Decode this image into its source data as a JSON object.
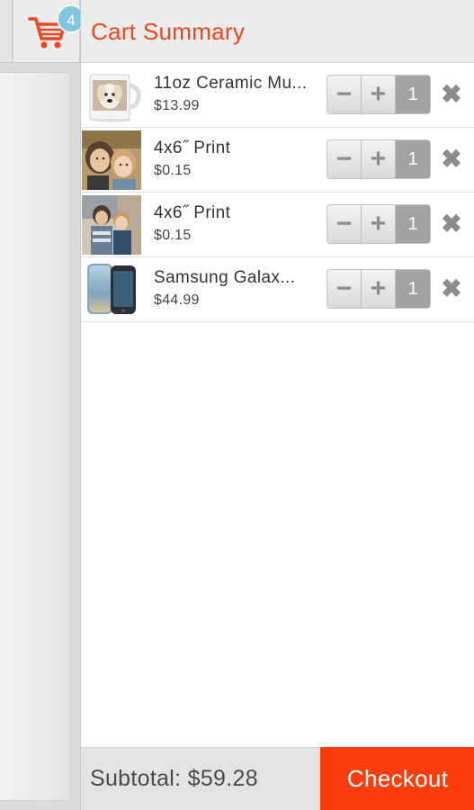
{
  "header": {
    "title": "Cart Summary",
    "cart_count": "4",
    "cart_icon": "shopping-cart-icon"
  },
  "items": [
    {
      "name": "11oz Ceramic Mu...",
      "price": "$13.99",
      "quantity": "1"
    },
    {
      "name": "4x6˝ Print",
      "price": "$0.15",
      "quantity": "1"
    },
    {
      "name": "4x6˝ Print",
      "price": "$0.15",
      "quantity": "1"
    },
    {
      "name": "Samsung Galax...",
      "price": "$44.99",
      "quantity": "1"
    }
  ],
  "controls": {
    "decrement_glyph": "−",
    "increment_glyph": "+",
    "remove_glyph": "✖"
  },
  "footer": {
    "subtotal": "Subtotal: $59.28",
    "checkout_label": "Checkout"
  },
  "colors": {
    "accent": "#f2441d",
    "checkout": "#fb3d0e",
    "badge": "#82c6dd"
  }
}
